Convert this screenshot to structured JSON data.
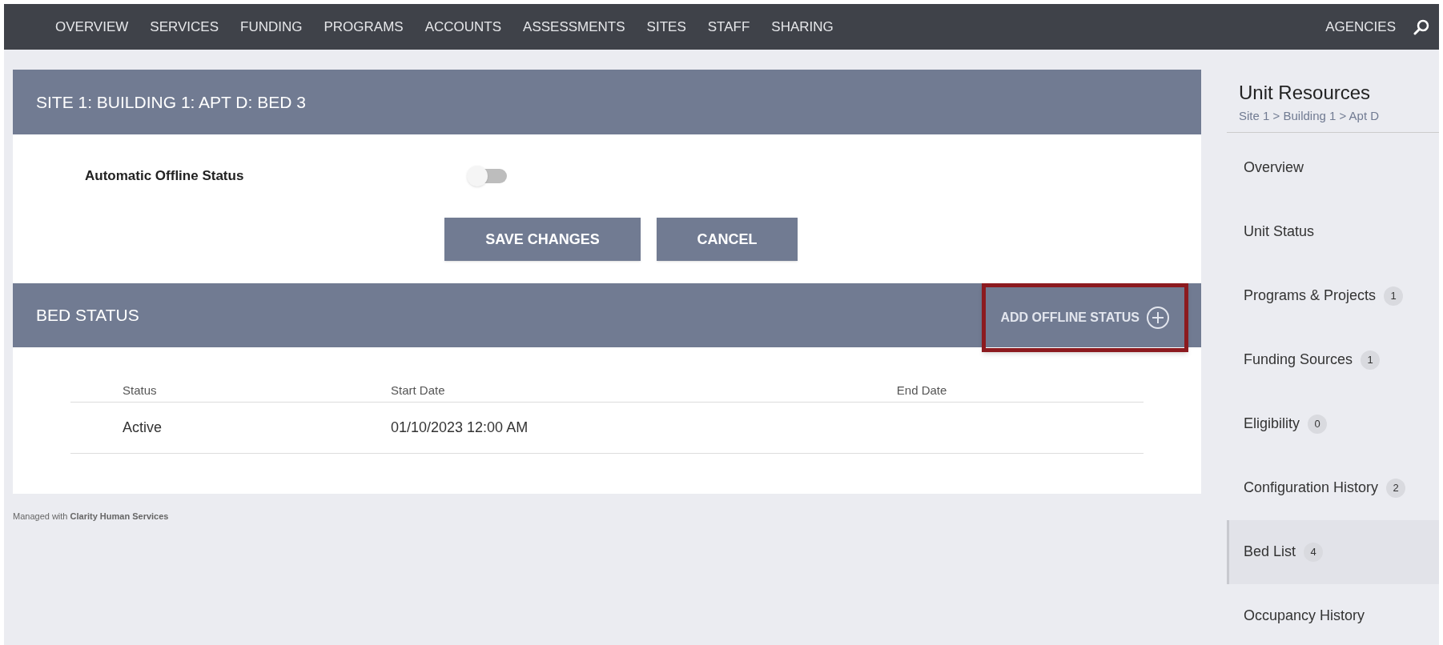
{
  "top_nav": {
    "items": [
      {
        "label": "OVERVIEW",
        "selected": false
      },
      {
        "label": "SERVICES",
        "selected": false
      },
      {
        "label": "FUNDING",
        "selected": false
      },
      {
        "label": "PROGRAMS",
        "selected": false
      },
      {
        "label": "ACCOUNTS",
        "selected": false
      },
      {
        "label": "ASSESSMENTS",
        "selected": false
      },
      {
        "label": "SITES",
        "selected": false
      },
      {
        "label": "STAFF",
        "selected": false
      },
      {
        "label": "SHARING",
        "selected": false
      }
    ],
    "right_label": "AGENCIES"
  },
  "unit_panel": {
    "title": "SITE 1: BUILDING 1: APT D: BED 3",
    "toggle": {
      "label": "Automatic Offline Status",
      "on": false
    },
    "buttons": [
      "SAVE CHANGES",
      "CANCEL"
    ]
  },
  "bed_status": {
    "title": "BED STATUS",
    "action": {
      "label": "ADD OFFLINE STATUS",
      "highlighted": true
    },
    "table": {
      "columns": [
        "Status",
        "Start Date",
        "End Date"
      ],
      "rows": [
        [
          "Active",
          "01/10/2023 12:00 AM",
          ""
        ]
      ]
    }
  },
  "footer": "Managed with **Clarity Human Services**",
  "sidebar": {
    "title": "Unit Resources",
    "breadcrumb": "Site 1 > Building 1 > Apt D",
    "items": [
      {
        "label": "Overview",
        "selected": false
      },
      {
        "label": "Unit Status",
        "selected": false
      },
      {
        "label": "Programs & Projects",
        "count": "1",
        "selected": false
      },
      {
        "label": "Funding Sources",
        "count": "1",
        "selected": false
      },
      {
        "label": "Eligibility",
        "count": "0",
        "selected": false
      },
      {
        "label": "Configuration History",
        "count": "2",
        "selected": false
      },
      {
        "label": "Bed List",
        "count": "4",
        "selected": true
      },
      {
        "label": "Occupancy History",
        "selected": false
      }
    ]
  }
}
